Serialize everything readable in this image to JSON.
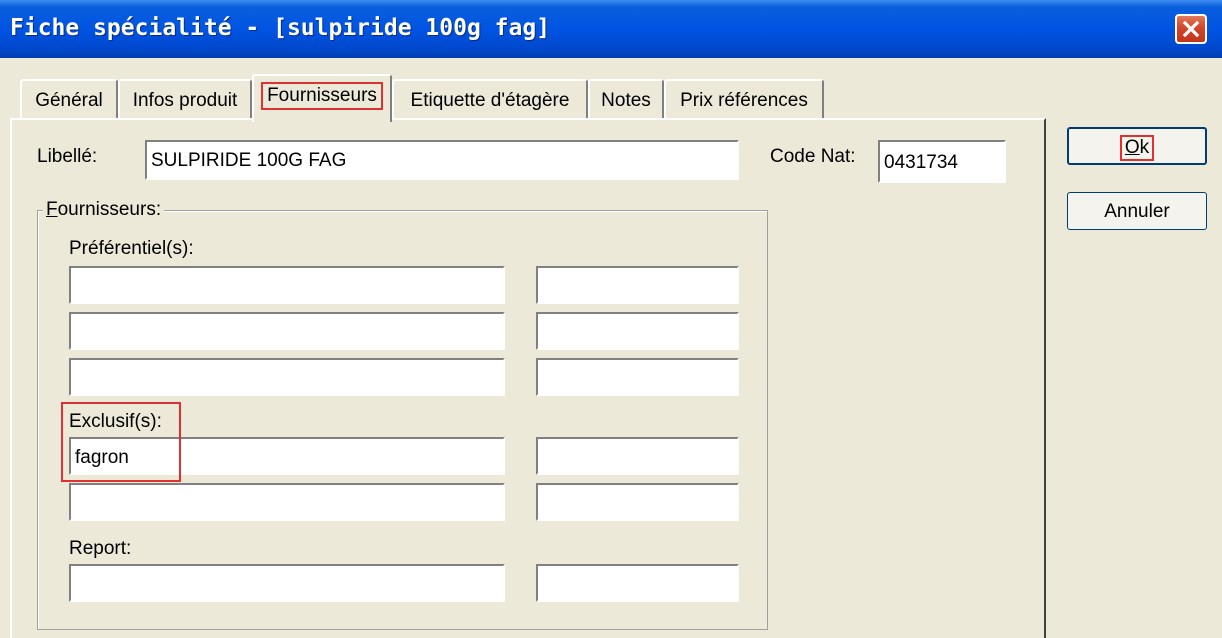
{
  "window": {
    "title": "Fiche spécialité - [sulpiride 100g fag]",
    "close_icon": "close-icon"
  },
  "tabs": [
    {
      "label": "Général",
      "active": false
    },
    {
      "label": "Infos produit",
      "active": false
    },
    {
      "label": "Fournisseurs",
      "active": true
    },
    {
      "label": "Etiquette d'étagère",
      "active": false
    },
    {
      "label": "Notes",
      "active": false
    },
    {
      "label": "Prix références",
      "active": false
    }
  ],
  "form": {
    "libelle_label": "Libellé:",
    "libelle_value": "SULPIRIDE 100G FAG",
    "code_nat_label": "Code Nat:",
    "code_nat_value": "0431734"
  },
  "fournisseurs": {
    "group_label_access": "F",
    "group_label_rest": "ournisseurs:",
    "preferentiels_label": "Préférentiel(s):",
    "exclusifs_label": "Exclusif(s):",
    "exclusif_1_value": "fagron",
    "report_label": "Report:"
  },
  "buttons": {
    "ok_access": "O",
    "ok_rest": "k",
    "cancel": "Annuler"
  },
  "colors": {
    "titlebar": "#0054e3",
    "highlight": "#e03030",
    "dialog_bg": "#ece9d8"
  }
}
